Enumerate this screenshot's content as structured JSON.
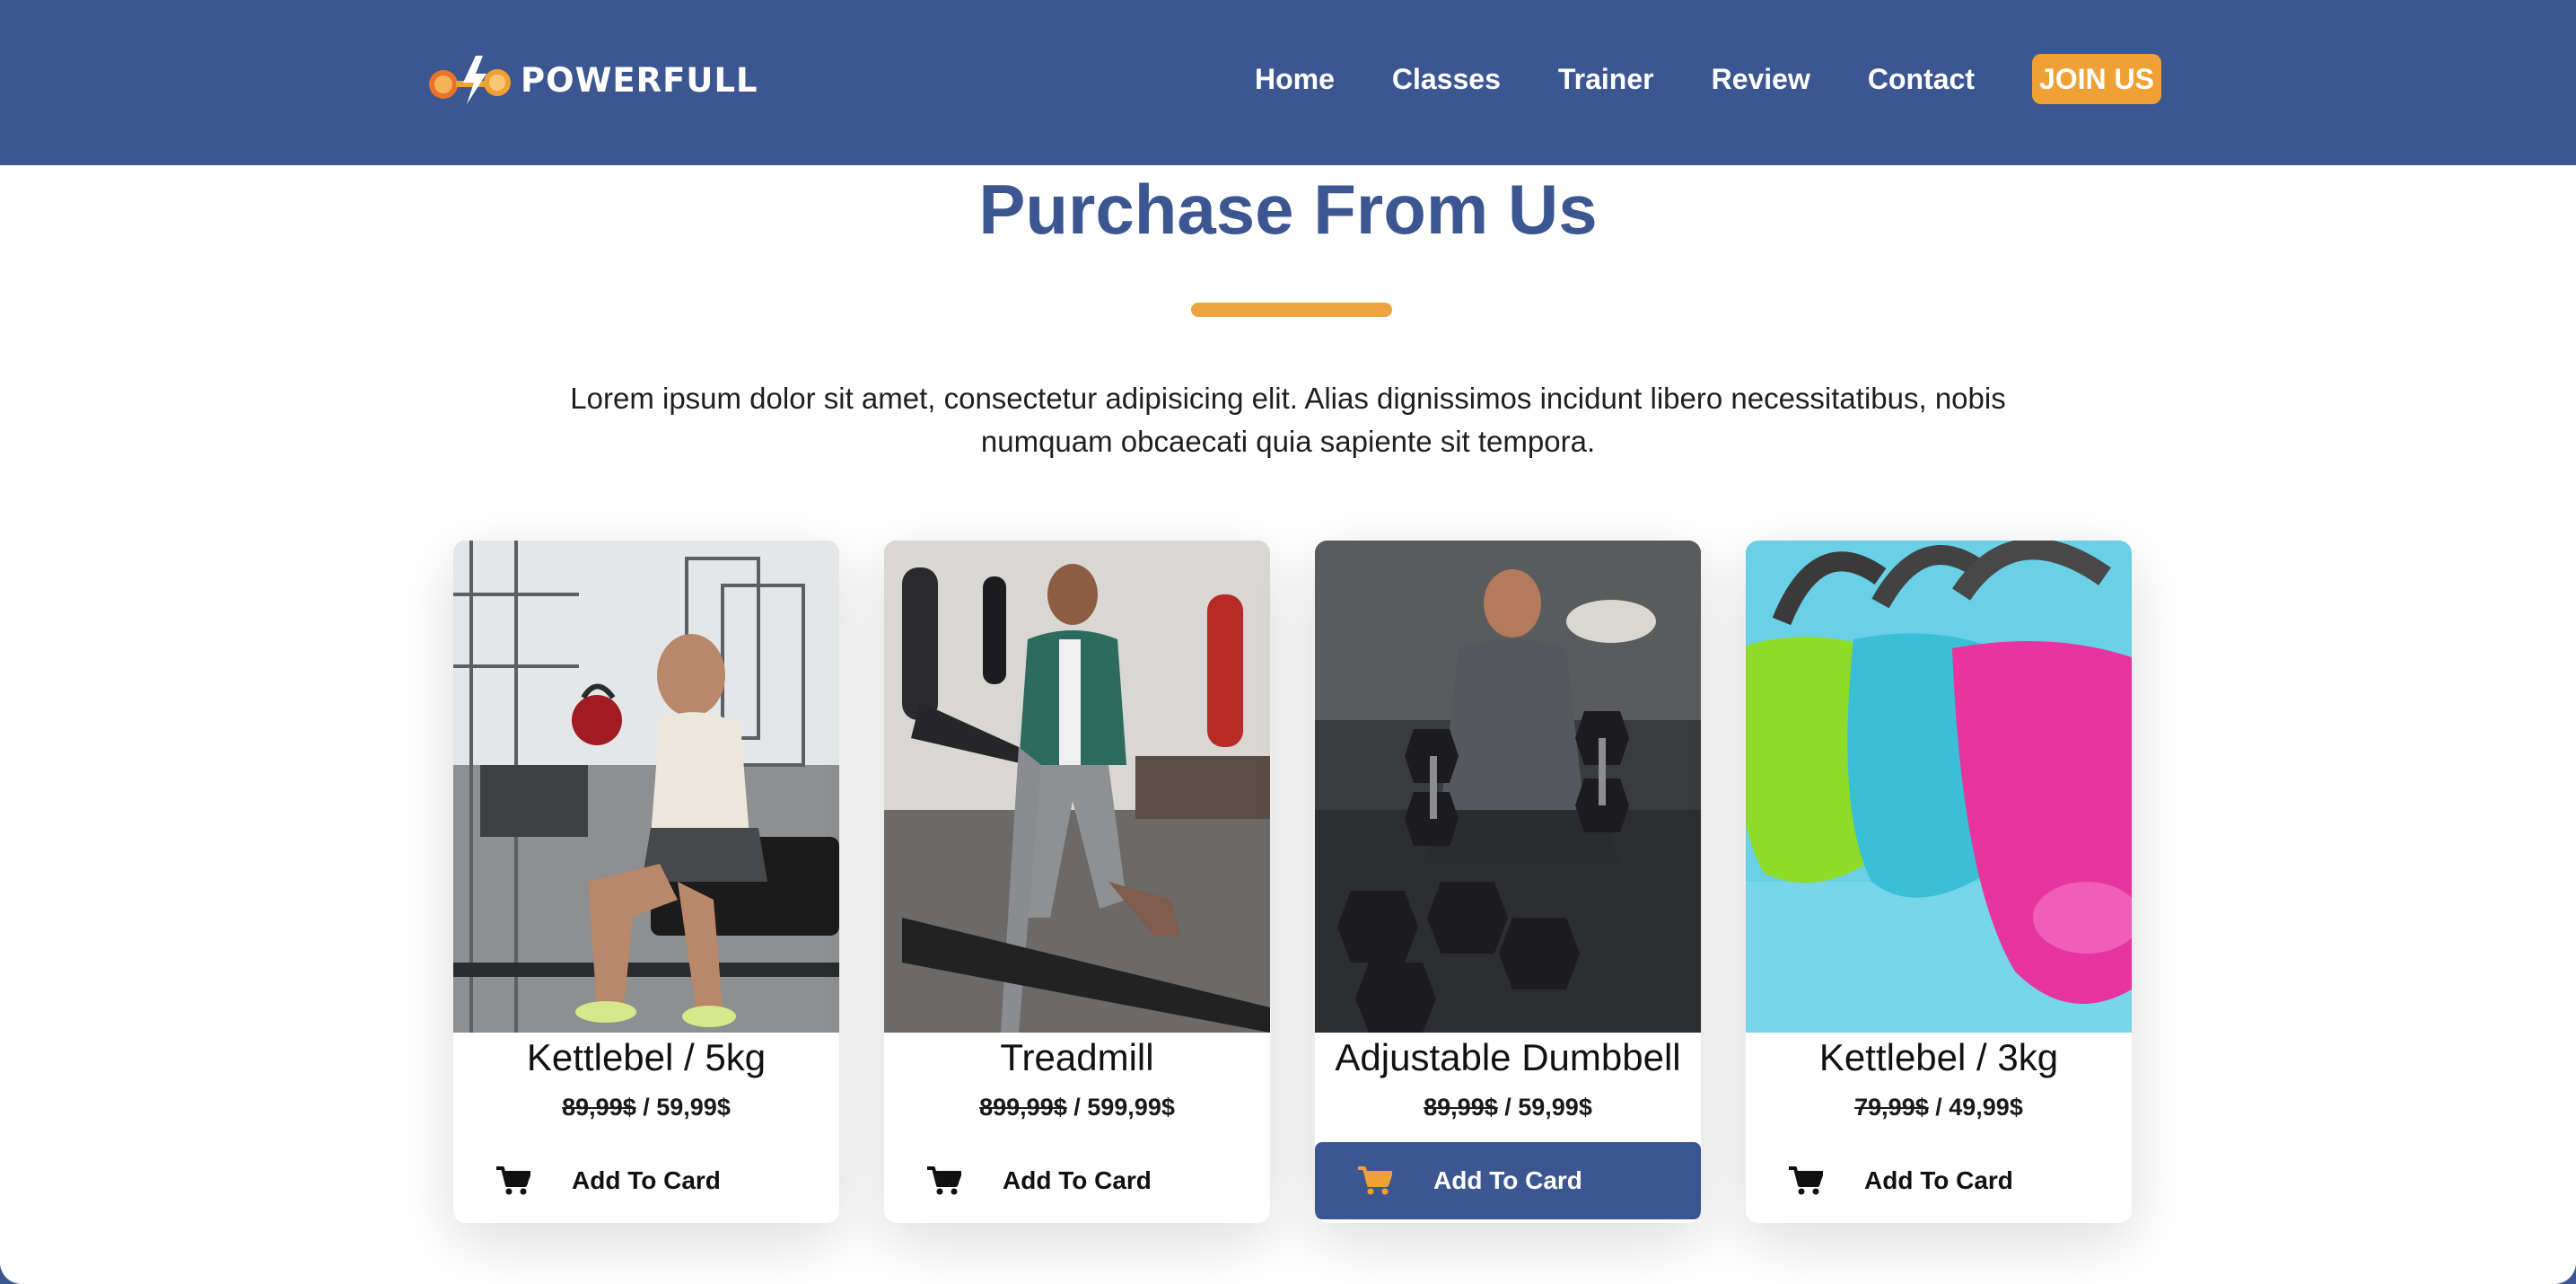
{
  "nav": {
    "logo_text": "POWERFULL",
    "links": [
      "Home",
      "Classes",
      "Trainer",
      "Review",
      "Contact"
    ],
    "cta": "JOIN US"
  },
  "section": {
    "title": "Purchase From Us",
    "description": "Lorem ipsum dolor sit amet, consectetur adipisicing elit. Alias dignissimos incidunt libero necessitatibus, nobis numquam obcaecati quia sapiente sit tempora."
  },
  "products": [
    {
      "name": "Kettlebel / 5kg",
      "old_price": "89,99$",
      "new_price": "59,99$",
      "button": "Add To Card",
      "active": false,
      "image": "man-with-kettlebell-photo"
    },
    {
      "name": "Treadmill",
      "old_price": "899,99$",
      "new_price": "599,99$",
      "button": "Add To Card",
      "active": false,
      "image": "man-on-treadmill-photo"
    },
    {
      "name": "Adjustable Dumbbell",
      "old_price": "89,99$",
      "new_price": "59,99$",
      "button": "Add To Card",
      "active": true,
      "image": "man-with-dumbbells-photo"
    },
    {
      "name": "Kettlebel / 3kg",
      "old_price": "79,99$",
      "new_price": "49,99$",
      "button": "Add To Card",
      "active": false,
      "image": "colorful-kettlebells-photo"
    }
  ],
  "colors": {
    "primary": "#3b5690",
    "accent": "#f0a135",
    "white": "#ffffff"
  },
  "icons": {
    "cart": "shopping-cart-icon",
    "logo": "dumbbell-lightning-icon"
  }
}
